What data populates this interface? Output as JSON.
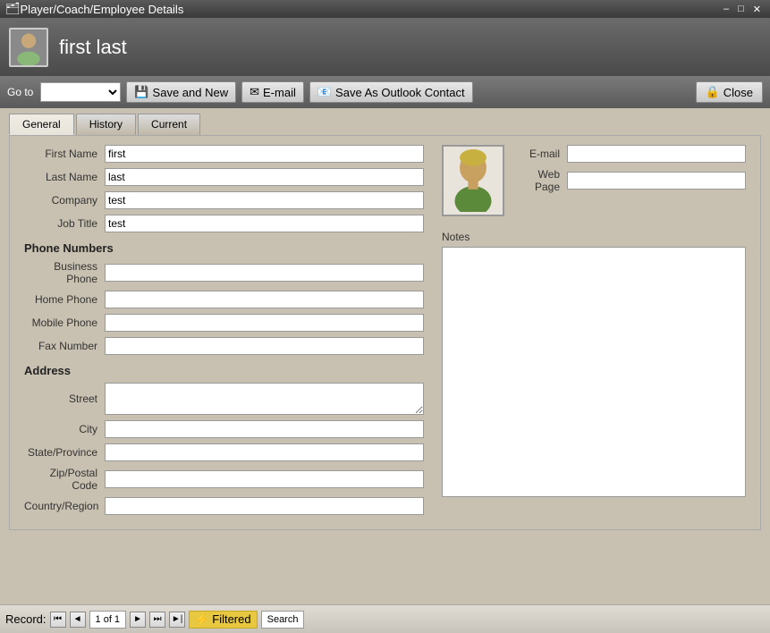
{
  "titleBar": {
    "title": "Player/Coach/Employee Details",
    "minBtn": "–",
    "maxBtn": "□",
    "closeBtn": "✕"
  },
  "header": {
    "name": "first last"
  },
  "toolbar": {
    "gotoLabel": "Go to",
    "gotoOptions": [
      ""
    ],
    "saveAndNewLabel": "Save and New",
    "emailLabel": "E-mail",
    "saveAsOutlookLabel": "Save As Outlook Contact",
    "closeLabel": "Close"
  },
  "tabs": [
    {
      "label": "General",
      "active": true
    },
    {
      "label": "History",
      "active": false
    },
    {
      "label": "Current",
      "active": false
    }
  ],
  "form": {
    "firstName": {
      "label": "First Name",
      "value": "first"
    },
    "lastName": {
      "label": "Last Name",
      "value": "last"
    },
    "company": {
      "label": "Company",
      "value": "test"
    },
    "jobTitle": {
      "label": "Job Title",
      "value": "test"
    },
    "phoneNumbers": {
      "sectionTitle": "Phone Numbers",
      "businessPhone": {
        "label": "Business Phone",
        "value": ""
      },
      "homePhone": {
        "label": "Home Phone",
        "value": ""
      },
      "mobilePhone": {
        "label": "Mobile Phone",
        "value": ""
      },
      "faxNumber": {
        "label": "Fax Number",
        "value": ""
      }
    },
    "address": {
      "sectionTitle": "Address",
      "street": {
        "label": "Street",
        "value": ""
      },
      "city": {
        "label": "City",
        "value": ""
      },
      "stateProvince": {
        "label": "State/Province",
        "value": ""
      },
      "zipPostalCode": {
        "label": "Zip/Postal Code",
        "value": ""
      },
      "countryRegion": {
        "label": "Country/Region",
        "value": ""
      }
    },
    "email": {
      "label": "E-mail",
      "value": ""
    },
    "webPage": {
      "label": "Web Page",
      "value": ""
    },
    "notes": {
      "label": "Notes"
    }
  },
  "statusBar": {
    "recordLabel": "Record:",
    "firstBtn": "⏮",
    "prevBtn": "◄",
    "recordValue": "1 of 1",
    "nextBtn": "►",
    "lastBtn": "⏭",
    "newBtn": "►|",
    "filteredLabel": "Filtered",
    "searchLabel": "Search"
  }
}
